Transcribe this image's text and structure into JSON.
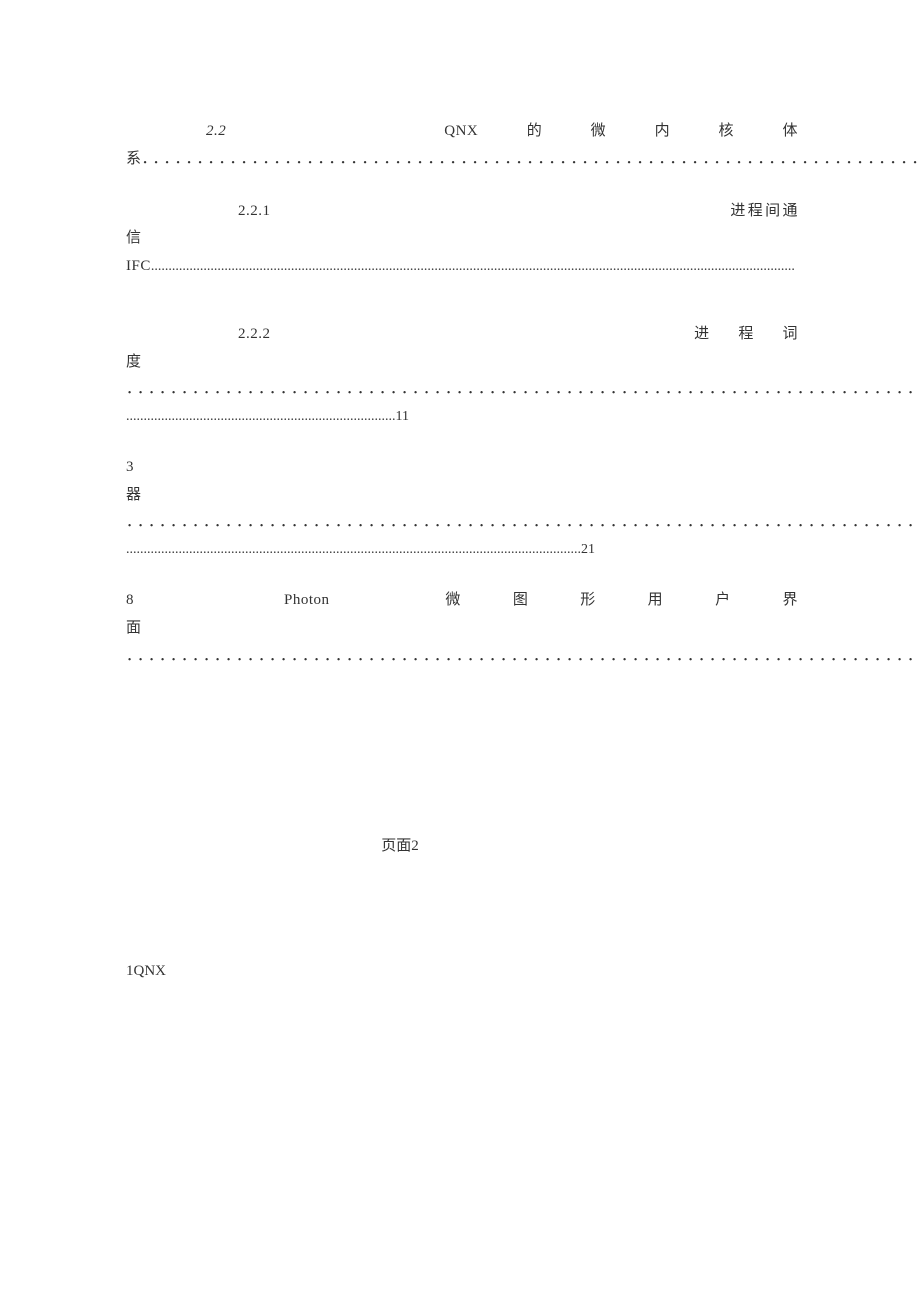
{
  "toc": {
    "e1": {
      "num": "2.2",
      "title": "QNX的微内核体",
      "trail_word": "系",
      "dots": "．．．．．．．．．．．．．．．．．．．．．．．．．．．．．．．．．．．．．．．．．．．．．．．．．．．．．．．．．．．．．．．．．．．．．．．．．．．．．"
    },
    "e2": {
      "num": "2.2.1",
      "title": "进程间通信",
      "trail_word": "IFC",
      "dots": "........................................................................................................................................................................................"
    },
    "e3": {
      "num": "2.2.2",
      "title": "进程词",
      "trail_word": "度",
      "dots1": "．．．．．．．．．．．．．．．．．．．．．．．．．．．．．．．．．．．．．．．．．．．．．．．．．．．．．．．．．．．．．．．．．．．．．．．．．．．．",
      "dots2": ".............................................................................11"
    },
    "e4": {
      "num": "3",
      "trail_word": "器",
      "dots1": "．．．．．．．．．．．．．．．．．．．．．．．．．．．．．．．．．．．．．．．．．．．．．．．．．．．．．．．．．．．．．．．．．．．．．．．．．．．．",
      "dots2": "..................................................................................................................................21"
    },
    "e5": {
      "num": "8",
      "label1": "Photon",
      "label2": "微图形用户界",
      "trail_word": "面",
      "dots": "．．．．．．．．．．．．．．．．．．．．．．．．．．．．．．．．．．．．．．．．．．．．．．．．．．．．．．．．．．．．．．．．．．．．．．．．．．．．"
    }
  },
  "page_marker": "页面2",
  "section_heading": "1QNX"
}
